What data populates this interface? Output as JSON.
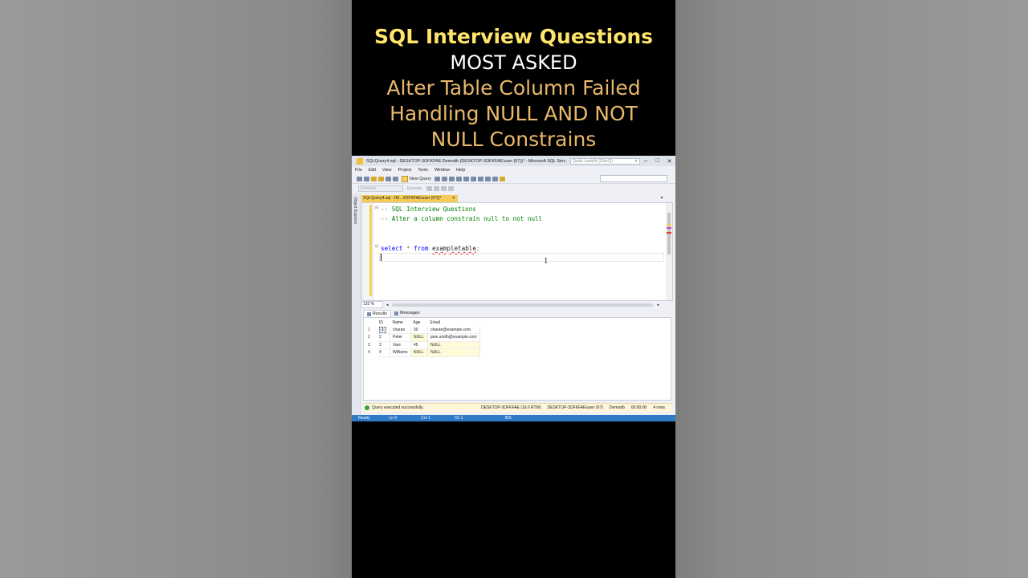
{
  "overlay": {
    "line1": "SQL Interview Questions",
    "line2": "MOST ASKED",
    "line3": "Alter Table Column Failed",
    "line4": "Handling NULL AND NOT",
    "line5": "NULL Constrains"
  },
  "window": {
    "title": "SQLQuery4.sql - DESKTOP-3OFKFAE.Demodb (DESKTOP-3OFKFAE\\user (67))* - Microsoft SQL Serve...",
    "quick_launch_placeholder": "Quick Launch (Ctrl+Q)",
    "controls": {
      "minimize": "–",
      "maximize": "□",
      "close": "✕"
    }
  },
  "menu": [
    "File",
    "Edit",
    "View",
    "Project",
    "Tools",
    "Window",
    "Help"
  ],
  "toolbar": {
    "new_query": "New Query"
  },
  "toolbar2": {
    "database": "Demodb",
    "execute": "Execute"
  },
  "side_panel": {
    "label": "Object Explorer"
  },
  "doc_tab": {
    "label": "SQLQuery4.sql - DE...3OFKFAE\\user (67))*",
    "pin": "⊣",
    "close": "✕"
  },
  "editor": {
    "comment1": "-- SQL Interview Questions",
    "comment2": "-- Alter a column constrain null to not null",
    "select_kw": "select",
    "star": "*",
    "from_kw": "from",
    "table": "exampletable",
    "semicolon": ";"
  },
  "zoom": "133 %",
  "result_tabs": {
    "results": "Results",
    "messages": "Messages"
  },
  "results": {
    "columns": [
      "ID",
      "Name",
      "Age",
      "Email"
    ],
    "rows": [
      {
        "rn": "1",
        "id": "1",
        "name": "charan",
        "age": "30",
        "email": "charan@example.com"
      },
      {
        "rn": "2",
        "id": "2",
        "name": "Peter",
        "age": "NULL",
        "email": "jane.smith@example.com"
      },
      {
        "rn": "3",
        "id": "3",
        "name": "Vani",
        "age": "45",
        "email": "NULL"
      },
      {
        "rn": "4",
        "id": "4",
        "name": "Williams",
        "age": "NULL",
        "email": "NULL"
      }
    ]
  },
  "query_status": {
    "message": "Query executed successfully.",
    "server": "DESKTOP-3OFKFAE (16.0 RTM)",
    "user": "DESKTOP-3OFKFAE\\user (67)",
    "database": "Demodb",
    "time": "00:00:00",
    "rows": "4 rows"
  },
  "status_bar": {
    "ready": "Ready",
    "ln": "Ln 6",
    "col": "Col 1",
    "ch": "Ch 1",
    "ins": "INS"
  },
  "colors": {
    "accent_yellow": "#ffe46a",
    "accent_orange": "#e8b86a",
    "tab_gold": "#f5cc57",
    "status_blue": "#2f7ac4"
  }
}
